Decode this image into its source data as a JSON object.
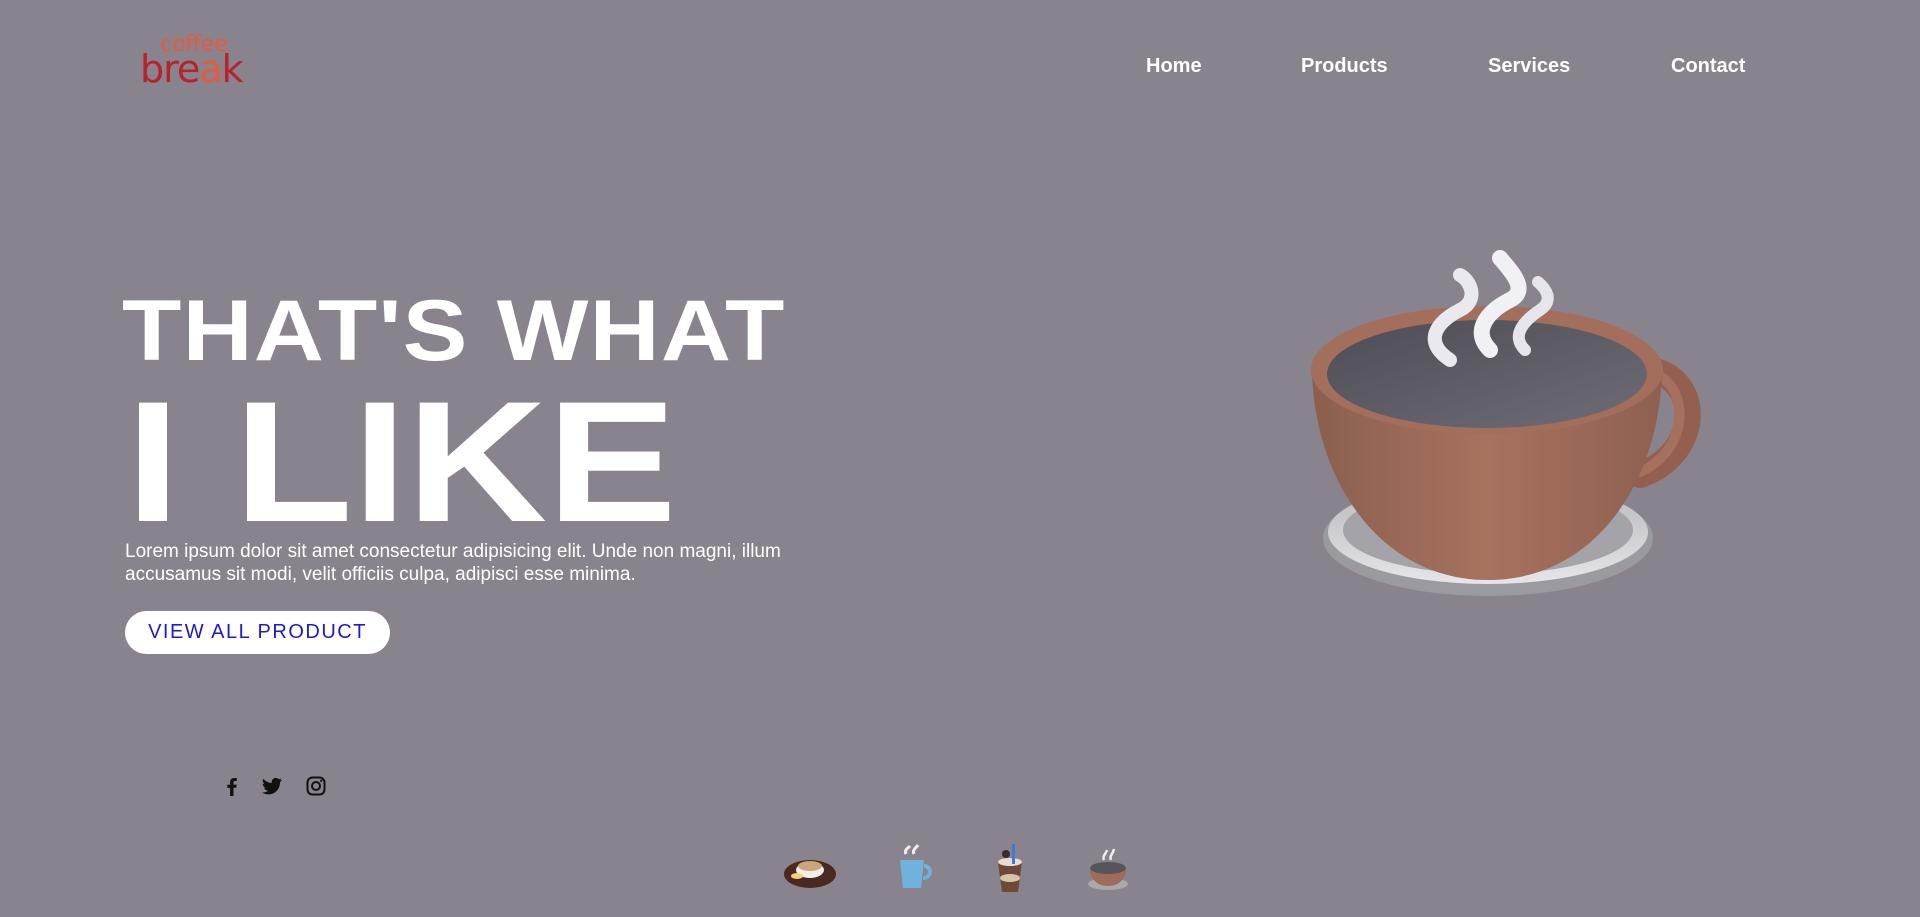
{
  "logo": {
    "top": "coffee",
    "bottom_a": "bre",
    "bottom_b": "a",
    "bottom_c": "k"
  },
  "nav": {
    "items": [
      {
        "label": "Home"
      },
      {
        "label": "Products"
      },
      {
        "label": "Services"
      },
      {
        "label": "Contact"
      }
    ]
  },
  "hero": {
    "line1": "THAT'S WHAT",
    "line2": "I LIKE",
    "description": "Lorem ipsum dolor sit amet consectetur adipisicing elit. Unde non magni, illum accusamus sit modi, velit officiis culpa, adipisci esse minima.",
    "cta_label": "VIEW ALL PRODUCT"
  },
  "social": {
    "icons": [
      "facebook-icon",
      "twitter-icon",
      "instagram-icon"
    ]
  },
  "hero_image": {
    "icon": "coffee-cup-illustration"
  },
  "thumbnails": {
    "icons": [
      "latte-cup-thumb",
      "blue-mug-thumb",
      "iced-coffee-thumb",
      "coffee-cup-thumb"
    ]
  },
  "colors": {
    "background": "#88838c",
    "cta_text": "#1b1bd1",
    "logo_accent": "#e8593f",
    "logo_dark": "#b8232b"
  }
}
